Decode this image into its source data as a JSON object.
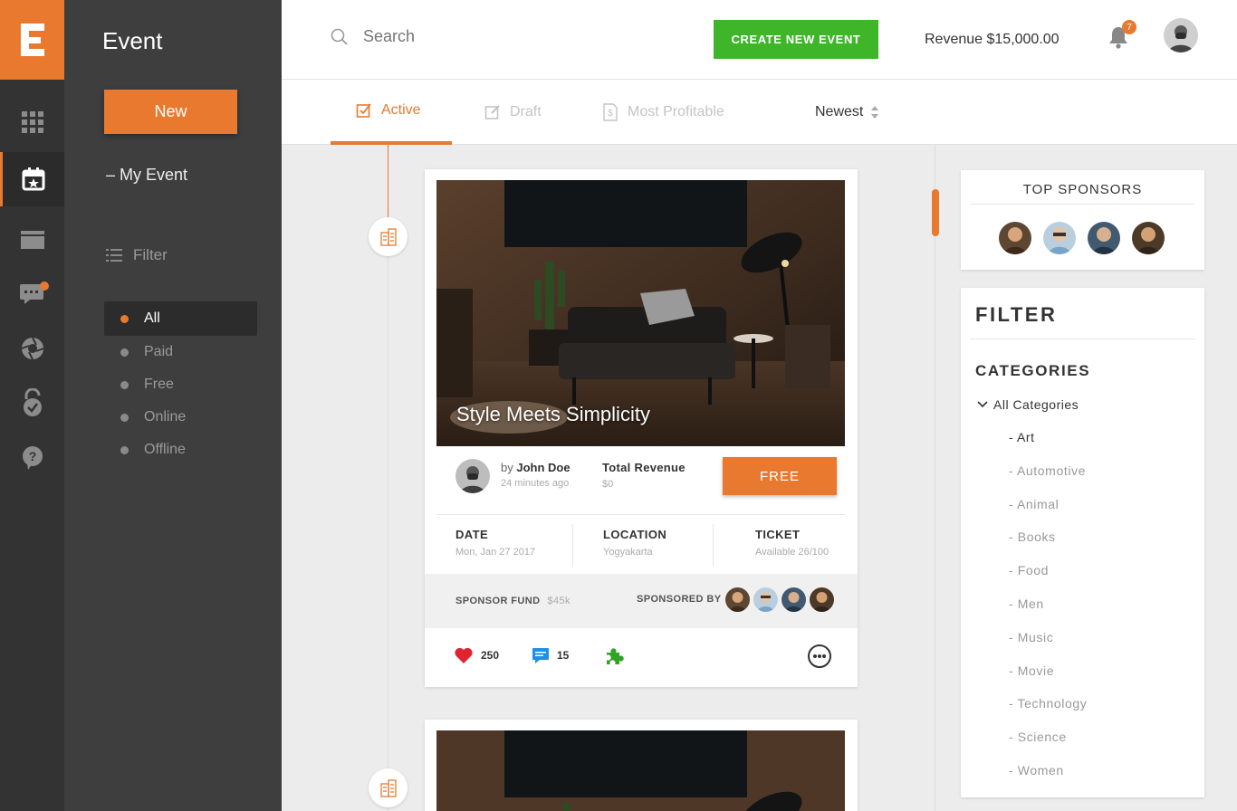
{
  "colors": {
    "accent": "#e8792f",
    "green": "#3fb52a",
    "dark": "#333333",
    "sidebar": "#3e3e3e"
  },
  "rail": {
    "logo_letter": "E",
    "items": [
      {
        "icon": "grid-icon"
      },
      {
        "icon": "calendar-star-icon",
        "active": true
      },
      {
        "icon": "folder-icon"
      },
      {
        "icon": "chat-icon",
        "badge": true
      },
      {
        "icon": "aperture-icon"
      },
      {
        "icon": "lock-check-icon"
      },
      {
        "icon": "help-icon"
      }
    ]
  },
  "sidebar": {
    "title": "Event",
    "new_label": "New",
    "my_event": "– My Event",
    "filter_label": "Filter",
    "filters": [
      "All",
      "Paid",
      "Free",
      "Online",
      "Offline"
    ]
  },
  "header": {
    "search_placeholder": "Search",
    "create_label": "CREATE NEW EVENT",
    "revenue": "Revenue $15,000.00",
    "notifications": "7"
  },
  "tabs": {
    "active": "Active",
    "draft": "Draft",
    "profitable": "Most Profitable",
    "sort": "Newest"
  },
  "card": {
    "title": "Style Meets Simplicity",
    "by": "by",
    "author": "John Doe",
    "time": "24 minutes ago",
    "total_label": "Total Revenue",
    "total_value": "$0",
    "price_label": "FREE",
    "date_label": "DATE",
    "date_value": "Mon, Jan 27 2017",
    "location_label": "LOCATION",
    "location_value": "Yogyakarta",
    "ticket_label": "TICKET",
    "ticket_value": "Available 26/100",
    "sponsor_fund_label": "SPONSOR FUND",
    "sponsor_fund_value": "$45k",
    "sponsored_by": "SPONSORED BY",
    "likes": "250",
    "comments": "15"
  },
  "top_sponsors": {
    "title": "TOP SPONSORS"
  },
  "filter_panel": {
    "title": "FILTER",
    "categories_label": "CATEGORIES",
    "all_label": "All Categories",
    "categories": [
      "- Art",
      "- Automotive",
      "- Animal",
      "- Books",
      "- Food",
      "- Men",
      "- Music",
      "- Movie",
      "- Technology",
      "- Science",
      "- Women"
    ]
  }
}
